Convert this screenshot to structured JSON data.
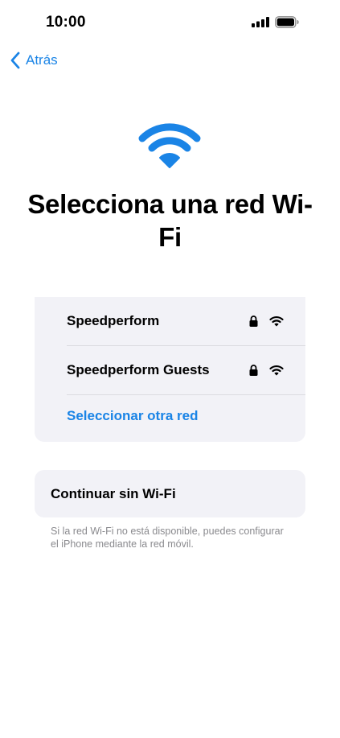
{
  "status_bar": {
    "time": "10:00"
  },
  "nav": {
    "back_label": "Atrás"
  },
  "title": "Selecciona una red Wi-Fi",
  "networks": [
    {
      "name": "Speedperform",
      "secured": true
    },
    {
      "name": "Speedperform Guests",
      "secured": true
    }
  ],
  "other_network_label": "Seleccionar otra red",
  "continue_without_wifi_label": "Continuar sin Wi-Fi",
  "footnote": "Si la red Wi-Fi no está disponible, puedes configurar el iPhone mediante la red móvil.",
  "colors": {
    "accent": "#1a84e6",
    "card_bg": "#f2f2f7",
    "footnote": "#8a8a8e"
  },
  "icons": [
    "signal-bars-icon",
    "battery-icon",
    "chevron-left-icon",
    "wifi-icon",
    "lock-icon"
  ]
}
